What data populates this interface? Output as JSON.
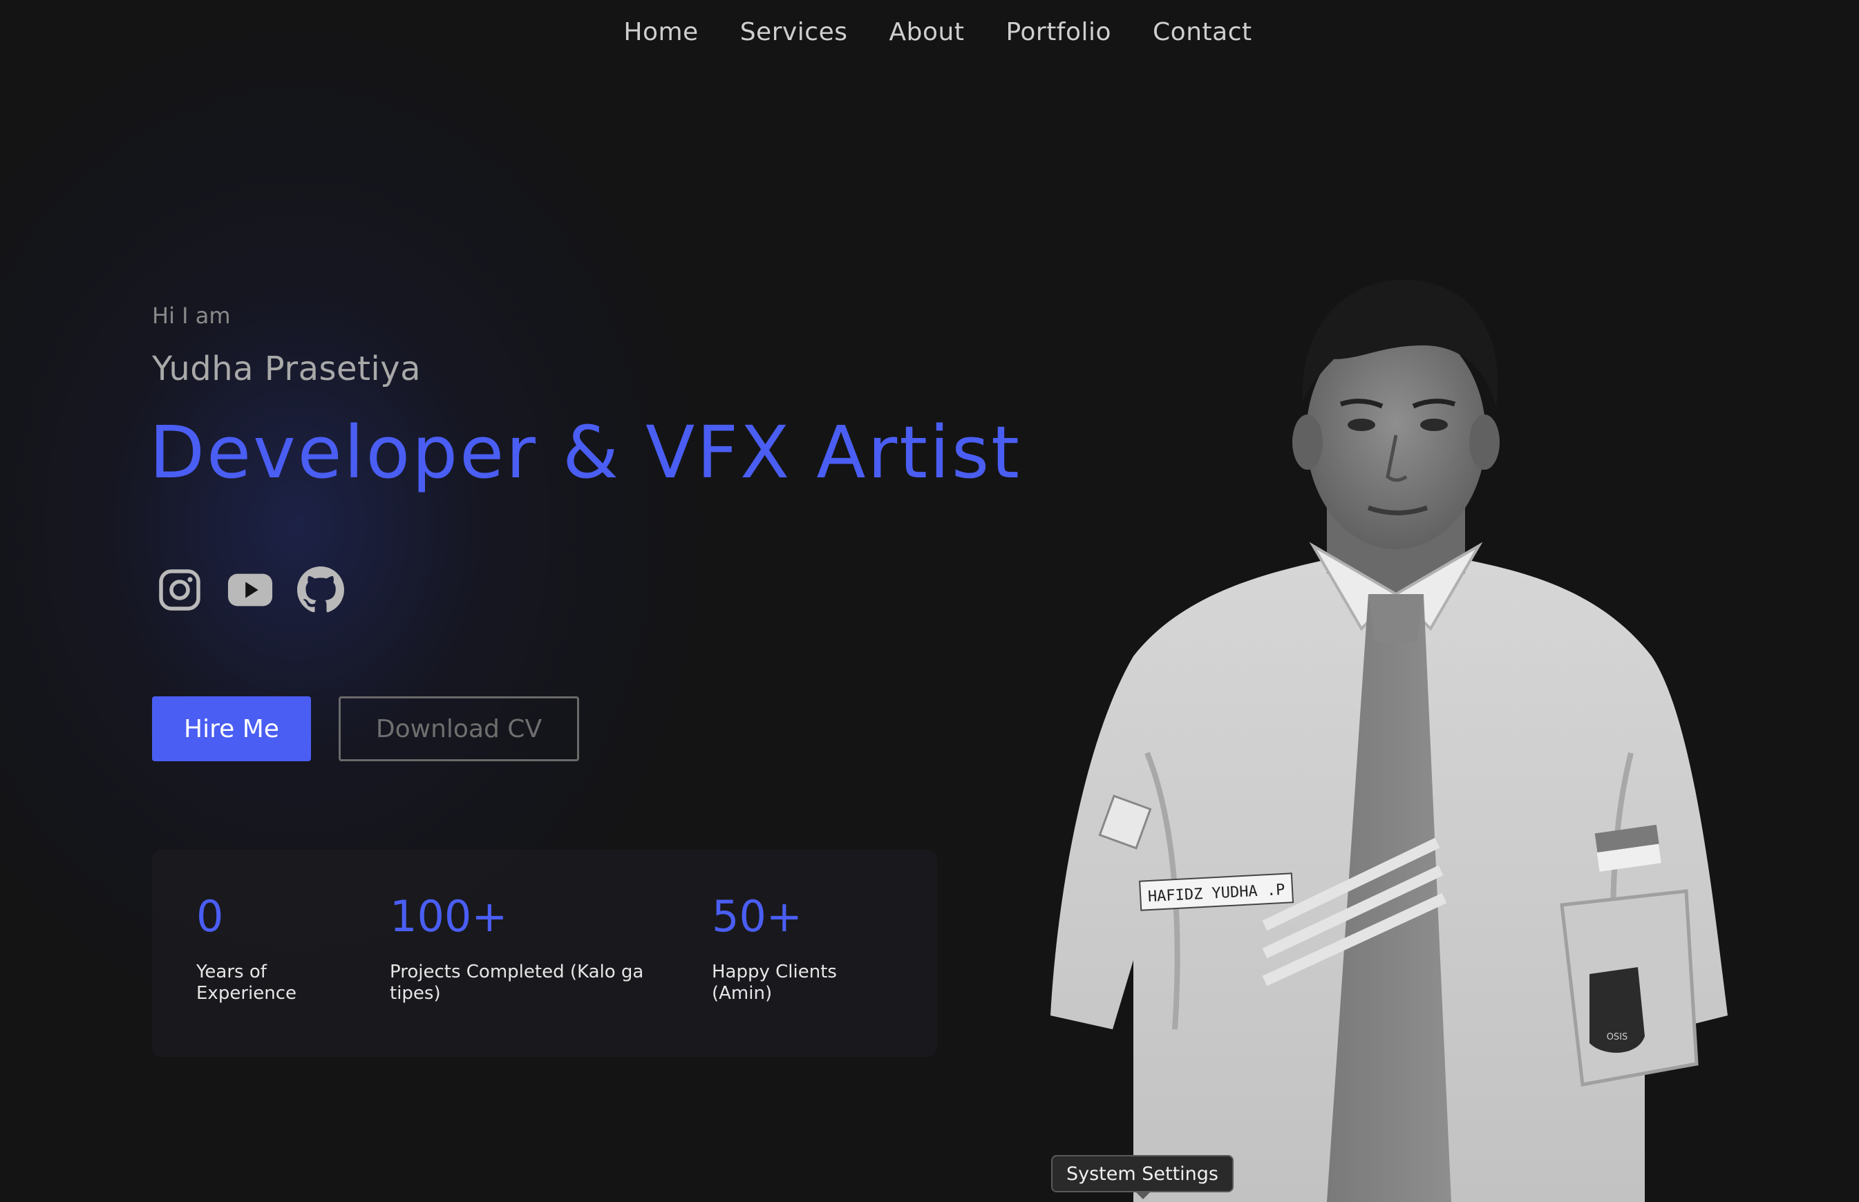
{
  "nav": {
    "items": [
      {
        "label": "Home"
      },
      {
        "label": "Services"
      },
      {
        "label": "About"
      },
      {
        "label": "Portfolio"
      },
      {
        "label": "Contact"
      }
    ]
  },
  "hero": {
    "greeting": "Hi I am",
    "name": "Yudha Prasetiya",
    "role": "Developer & VFX Artist",
    "accent_color": "#4a5ef3"
  },
  "socials": [
    {
      "icon": "instagram-icon"
    },
    {
      "icon": "youtube-icon"
    },
    {
      "icon": "github-icon"
    }
  ],
  "buttons": {
    "hire": "Hire Me",
    "download_cv": "Download CV"
  },
  "stats": [
    {
      "value": "0",
      "label": "Years of Experience"
    },
    {
      "value": "100+",
      "label": "Projects Completed (Kalo ga tipes)"
    },
    {
      "value": "50+",
      "label": "Happy Clients (Amin)"
    }
  ],
  "portrait": {
    "badge_text": "HAFIDZ YUDHA .P",
    "emblem_text": "OSIS"
  },
  "tooltip": {
    "text": "System Settings"
  }
}
